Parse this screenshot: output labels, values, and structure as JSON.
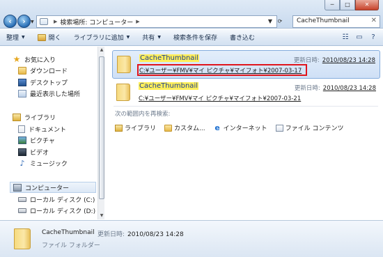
{
  "window": {
    "address": {
      "crumbs": [
        "検索場所: コンピューター"
      ],
      "search_value": "CacheThumbnail"
    },
    "controls": {
      "minimize": "─",
      "maximize": "□",
      "close": "✕"
    }
  },
  "toolbar": {
    "organize": "整理",
    "open": "開く",
    "add_to_library": "ライブラリに追加",
    "share": "共有",
    "save_search": "検索条件を保存",
    "burn": "書き込む"
  },
  "sidebar": {
    "favorites": {
      "header": "お気に入り",
      "items": [
        {
          "label": "ダウンロード",
          "icon": "folder-icon"
        },
        {
          "label": "デスクトップ",
          "icon": "desktop-icon"
        },
        {
          "label": "最近表示した場所",
          "icon": "recent-places-icon"
        }
      ]
    },
    "libraries": {
      "header": "ライブラリ",
      "items": [
        {
          "label": "ドキュメント",
          "icon": "document-icon"
        },
        {
          "label": "ピクチャ",
          "icon": "picture-icon"
        },
        {
          "label": "ビデオ",
          "icon": "video-icon"
        },
        {
          "label": "ミュージック",
          "icon": "music-icon"
        }
      ]
    },
    "computer": {
      "header": "コンピューター",
      "items": [
        {
          "label": "ローカル ディスク (C:)",
          "icon": "disk-icon"
        },
        {
          "label": "ローカル ディスク (D:)",
          "icon": "disk-icon"
        }
      ]
    }
  },
  "results": [
    {
      "name": "CacheThumbnail",
      "path": "C:¥ユーザー¥FMV¥マイ ピクチャ¥マイフォト¥2007-03-17",
      "date_label": "更新日時:",
      "date_value": "2010/08/23 14:28",
      "selected": true
    },
    {
      "name": "CacheThumbnail",
      "path": "C:¥ユーザー¥FMV¥マイ ピクチャ¥マイフォト¥2007-03-21",
      "date_label": "更新日時:",
      "date_value": "2010/08/23 14:28",
      "selected": false
    }
  ],
  "search_again": {
    "label": "次の範囲内を再検索:",
    "options": [
      {
        "label": "ライブラリ",
        "icon": "library-icon"
      },
      {
        "label": "カスタム...",
        "icon": "custom-icon"
      },
      {
        "label": "インターネット",
        "icon": "internet-icon"
      },
      {
        "label": "ファイル コンテンツ",
        "icon": "file-content-icon"
      }
    ]
  },
  "details": {
    "name": "CacheThumbnail",
    "date_label": "更新日時:",
    "date_value": "2010/08/23 14:28",
    "type": "ファイル フォルダー"
  },
  "colors": {
    "highlight": "#ffef5a",
    "annotation_box": "#e0141c",
    "selection": "#cfe0f6"
  }
}
